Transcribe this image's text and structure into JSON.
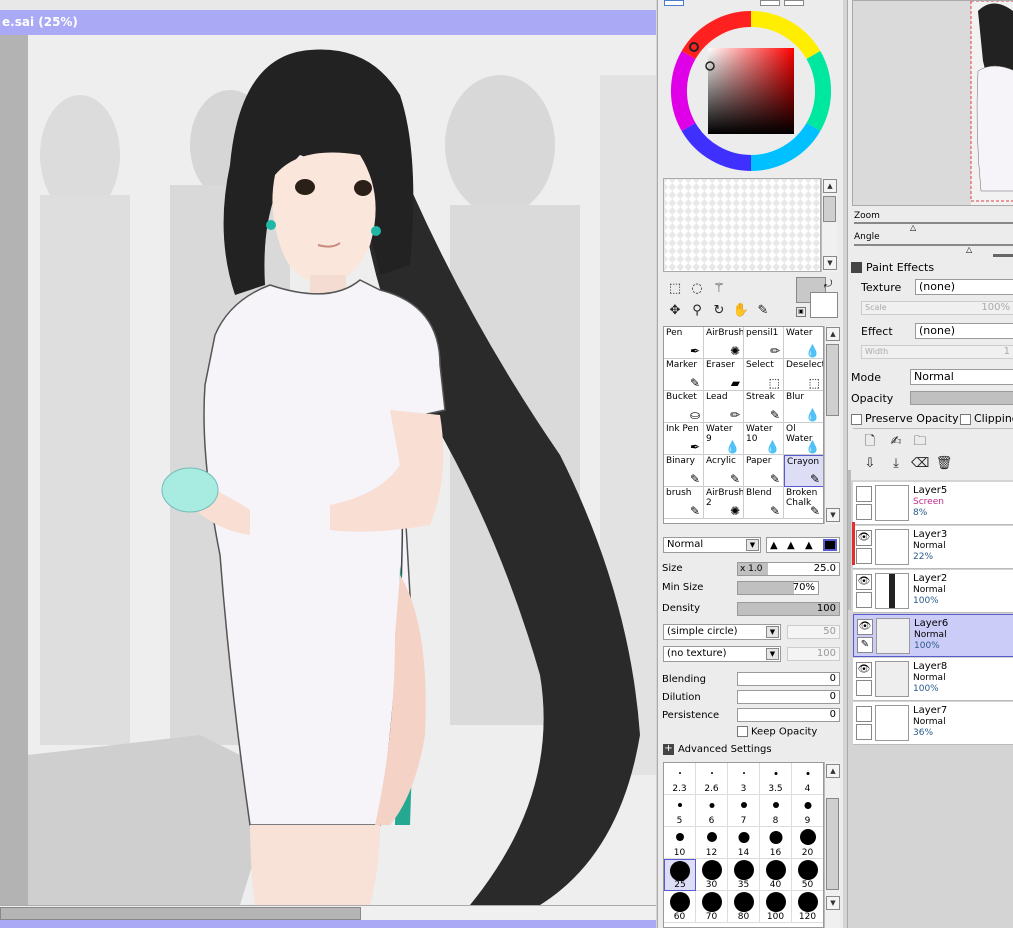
{
  "canvas": {
    "title": "e.sai (25%)"
  },
  "color": {
    "fg_swatch": "#c8c8c8",
    "bg_swatch": "#ffffff"
  },
  "tools": {
    "blend_mode": "Normal",
    "brushes": [
      {
        "label": "Pen",
        "icon": "pen-icon"
      },
      {
        "label": "AirBrush",
        "icon": "airbrush-icon"
      },
      {
        "label": "pensil1",
        "icon": "pencil-icon"
      },
      {
        "label": "Water",
        "icon": "water-icon"
      },
      {
        "label": "Marker",
        "icon": "marker-icon"
      },
      {
        "label": "Eraser",
        "icon": "eraser-icon"
      },
      {
        "label": "Select",
        "icon": "select-icon"
      },
      {
        "label": "Deselect",
        "icon": "deselect-icon"
      },
      {
        "label": "Bucket",
        "icon": "bucket-icon"
      },
      {
        "label": "Lead",
        "icon": "lead-icon"
      },
      {
        "label": "Streak",
        "icon": "streak-icon"
      },
      {
        "label": "Blur",
        "icon": "blur-icon"
      },
      {
        "label": "Ink Pen",
        "icon": "ink-pen-icon"
      },
      {
        "label": "Water 9",
        "icon": "water-icon"
      },
      {
        "label": "Water 10",
        "icon": "water-icon"
      },
      {
        "label": "Ol Water",
        "icon": "water-icon"
      },
      {
        "label": "Binary",
        "icon": "binary-icon"
      },
      {
        "label": "Acrylic",
        "icon": "acrylic-icon"
      },
      {
        "label": "Paper",
        "icon": "paper-icon"
      },
      {
        "label": "Crayon",
        "icon": "crayon-icon"
      },
      {
        "label": "brush",
        "icon": "brush-icon"
      },
      {
        "label": "AirBrush 2",
        "icon": "airbrush-icon"
      },
      {
        "label": "Blend",
        "icon": "blend-icon"
      },
      {
        "label": "Broken Chalk",
        "icon": "chalk-icon"
      }
    ],
    "selected_brush": "Crayon",
    "size_label": "Size",
    "size_mult": "x 1.0",
    "size_value": "25.0",
    "min_size_label": "Min Size",
    "min_size_value": "70%",
    "min_size_fraction": 0.7,
    "density_label": "Density",
    "density_value": "100",
    "density_fraction": 1.0,
    "shape": "(simple circle)",
    "shape_value": "50",
    "texture": "(no texture)",
    "texture_value": "100",
    "blending_label": "Blending",
    "blending_value": "0",
    "dilution_label": "Dilution",
    "dilution_value": "0",
    "persistence_label": "Persistence",
    "persistence_value": "0",
    "keep_opacity_label": "Keep Opacity",
    "advanced_label": "Advanced Settings",
    "dot_sizes": [
      "2.3",
      "2.6",
      "3",
      "3.5",
      "4",
      "5",
      "6",
      "7",
      "8",
      "9",
      "10",
      "12",
      "14",
      "16",
      "20",
      "25",
      "30",
      "35",
      "40",
      "50",
      "60",
      "70",
      "80",
      "100",
      "120"
    ],
    "selected_dot": "25"
  },
  "navigator": {
    "zoom_label": "Zoom",
    "angle_label": "Angle"
  },
  "effects": {
    "header": "Paint Effects",
    "texture_label": "Texture",
    "texture_value": "(none)",
    "scale_label": "Scale",
    "scale_value": "100%",
    "effect_label": "Effect",
    "effect_value": "(none)",
    "width_label": "Width",
    "width_value": "1"
  },
  "layer_props": {
    "mode_label": "Mode",
    "mode_value": "Normal",
    "opacity_label": "Opacity",
    "preserve_opacity_label": "Preserve Opacity",
    "clipping_label": "Clipping"
  },
  "layers": [
    {
      "name": "Layer5",
      "mode": "Screen",
      "opacity": "8%",
      "visible": false
    },
    {
      "name": "Layer3",
      "mode": "Normal",
      "opacity": "22%",
      "visible": true
    },
    {
      "name": "Layer2",
      "mode": "Normal",
      "opacity": "100%",
      "visible": true
    },
    {
      "name": "Layer6",
      "mode": "Normal",
      "opacity": "100%",
      "visible": true
    },
    {
      "name": "Layer8",
      "mode": "Normal",
      "opacity": "100%",
      "visible": true
    },
    {
      "name": "Layer7",
      "mode": "Normal",
      "opacity": "36%",
      "visible": false
    }
  ]
}
